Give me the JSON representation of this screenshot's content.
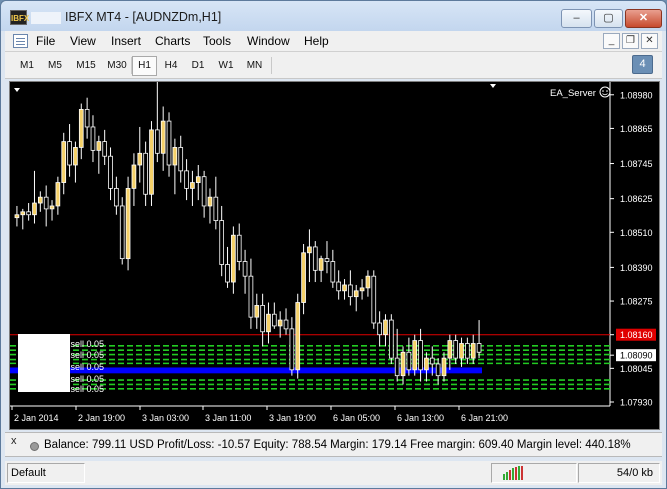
{
  "window": {
    "app_name": "IBFX MT4",
    "title": "IBFX MT4 - [AUDNZDm,H1]",
    "icon_label": "IBFX",
    "controls": {
      "minimize": "–",
      "maximize": "▢",
      "close": "✕"
    }
  },
  "menu": {
    "items": [
      "File",
      "View",
      "Insert",
      "Charts",
      "Tools",
      "Window",
      "Help"
    ],
    "mdi_controls": {
      "minimize": "_",
      "restore": "❐",
      "close": "✕"
    }
  },
  "timeframes": {
    "items": [
      "M1",
      "M5",
      "M15",
      "M30",
      "H1",
      "H4",
      "D1",
      "W1",
      "MN"
    ],
    "active": "H1",
    "badge": "4"
  },
  "chart": {
    "symbol": "AUDNZDm",
    "timeframe": "H1",
    "expert_label": "EA_Server",
    "expert_icon": "smiley-icon",
    "price_labels": [
      "1.08980",
      "1.08865",
      "1.08745",
      "1.08625",
      "1.08510",
      "1.08390",
      "1.08275",
      "1.08160",
      "1.08090",
      "1.08045",
      "1.07930"
    ],
    "time_labels": [
      "2 Jan 2014",
      "2 Jan 19:00",
      "3 Jan 03:00",
      "3 Jan 11:00",
      "3 Jan 19:00",
      "6 Jan 05:00",
      "6 Jan 13:00",
      "6 Jan 21:00"
    ],
    "order_labels": [
      "sell 0.05",
      "sell 0.05",
      "sell 0.05",
      "sell 0.05",
      "sell 0.05"
    ],
    "colors": {
      "background": "#000000",
      "bull_candle": "#f5d169",
      "bear_candle": "#000000",
      "candle_outline": "#ffffff",
      "bid_line": "#e00000",
      "order_lines": "#22cc22",
      "band": "#0000ff"
    }
  },
  "chart_data": {
    "type": "candlestick",
    "title": "",
    "xlabel": "",
    "ylabel": "",
    "ylim": [
      1.0793,
      1.0901
    ],
    "bid_price": 1.0816,
    "ask_price": 1.0809,
    "band": [
      1.08028,
      1.08048
    ],
    "order_levels": [
      1.08122,
      1.08107,
      1.08092,
      1.08075,
      1.08062,
      1.08005,
      1.0799,
      1.07975
    ],
    "candles": [
      [
        1.0856,
        1.086,
        1.0853,
        1.0857
      ],
      [
        1.0857,
        1.0859,
        1.0852,
        1.0858
      ],
      [
        1.0858,
        1.0861,
        1.0855,
        1.0857
      ],
      [
        1.0857,
        1.0872,
        1.0854,
        1.0861
      ],
      [
        1.0861,
        1.0865,
        1.0858,
        1.0863
      ],
      [
        1.0863,
        1.0867,
        1.0853,
        1.0859
      ],
      [
        1.0859,
        1.0862,
        1.0855,
        1.086
      ],
      [
        1.086,
        1.087,
        1.0857,
        1.0868
      ],
      [
        1.0868,
        1.0885,
        1.0864,
        1.0882
      ],
      [
        1.0882,
        1.0888,
        1.087,
        1.0874
      ],
      [
        1.0874,
        1.0882,
        1.0868,
        1.088
      ],
      [
        1.088,
        1.0895,
        1.0876,
        1.0893
      ],
      [
        1.0893,
        1.0897,
        1.0883,
        1.0887
      ],
      [
        1.0887,
        1.0891,
        1.0875,
        1.0879
      ],
      [
        1.0879,
        1.0884,
        1.0871,
        1.0882
      ],
      [
        1.0882,
        1.0886,
        1.0874,
        1.0877
      ],
      [
        1.0877,
        1.088,
        1.0862,
        1.0866
      ],
      [
        1.0866,
        1.087,
        1.0857,
        1.086
      ],
      [
        1.086,
        1.0863,
        1.084,
        1.0842
      ],
      [
        1.0842,
        1.087,
        1.0838,
        1.0866
      ],
      [
        1.0866,
        1.0878,
        1.086,
        1.0874
      ],
      [
        1.0874,
        1.0887,
        1.0868,
        1.0878
      ],
      [
        1.0878,
        1.0882,
        1.086,
        1.0864
      ],
      [
        1.0864,
        1.0889,
        1.086,
        1.0886
      ],
      [
        1.0886,
        1.0905,
        1.0875,
        1.0878
      ],
      [
        1.0878,
        1.0894,
        1.0872,
        1.0889
      ],
      [
        1.0889,
        1.0892,
        1.087,
        1.0874
      ],
      [
        1.0874,
        1.0883,
        1.0864,
        1.088
      ],
      [
        1.088,
        1.0884,
        1.0868,
        1.0872
      ],
      [
        1.0872,
        1.0876,
        1.0862,
        1.0866
      ],
      [
        1.0866,
        1.0872,
        1.086,
        1.0868
      ],
      [
        1.0868,
        1.0874,
        1.0862,
        1.087
      ],
      [
        1.087,
        1.0872,
        1.0856,
        1.086
      ],
      [
        1.086,
        1.0866,
        1.0854,
        1.0863
      ],
      [
        1.0863,
        1.087,
        1.0852,
        1.0855
      ],
      [
        1.0855,
        1.086,
        1.0836,
        1.084
      ],
      [
        1.084,
        1.0846,
        1.0832,
        1.0834
      ],
      [
        1.0834,
        1.0853,
        1.083,
        1.085
      ],
      [
        1.085,
        1.0854,
        1.0838,
        1.0841
      ],
      [
        1.0841,
        1.0845,
        1.083,
        1.0836
      ],
      [
        1.0836,
        1.0842,
        1.0818,
        1.0822
      ],
      [
        1.0822,
        1.083,
        1.0818,
        1.0826
      ],
      [
        1.0826,
        1.083,
        1.0812,
        1.0817
      ],
      [
        1.0817,
        1.0827,
        1.0813,
        1.0823
      ],
      [
        1.0823,
        1.0827,
        1.0818,
        1.0819
      ],
      [
        1.0819,
        1.0824,
        1.0815,
        1.0821
      ],
      [
        1.0821,
        1.0825,
        1.0816,
        1.0818
      ],
      [
        1.0818,
        1.0822,
        1.0802,
        1.0804
      ],
      [
        1.0804,
        1.083,
        1.0801,
        1.0827
      ],
      [
        1.0827,
        1.0847,
        1.0823,
        1.0844
      ],
      [
        1.0844,
        1.0852,
        1.0834,
        1.0846
      ],
      [
        1.0846,
        1.0848,
        1.0834,
        1.0838
      ],
      [
        1.0838,
        1.0843,
        1.0834,
        1.0842
      ],
      [
        1.0842,
        1.0848,
        1.0837,
        1.0841
      ],
      [
        1.0841,
        1.0845,
        1.0832,
        1.0834
      ],
      [
        1.0834,
        1.0838,
        1.0828,
        1.0831
      ],
      [
        1.0831,
        1.0835,
        1.0828,
        1.0833
      ],
      [
        1.0833,
        1.0838,
        1.0826,
        1.0829
      ],
      [
        1.0829,
        1.0833,
        1.0824,
        1.0831
      ],
      [
        1.0831,
        1.0835,
        1.0828,
        1.0832
      ],
      [
        1.0832,
        1.0838,
        1.0829,
        1.0836
      ],
      [
        1.0836,
        1.0838,
        1.0818,
        1.082
      ],
      [
        1.082,
        1.0824,
        1.0812,
        1.0816
      ],
      [
        1.0816,
        1.0823,
        1.0812,
        1.0821
      ],
      [
        1.0821,
        1.0823,
        1.0806,
        1.0808
      ],
      [
        1.0808,
        1.0818,
        1.08,
        1.0802
      ],
      [
        1.0802,
        1.0812,
        1.0799,
        1.081
      ],
      [
        1.081,
        1.0815,
        1.0802,
        1.0804
      ],
      [
        1.0804,
        1.0816,
        1.0802,
        1.0814
      ],
      [
        1.0814,
        1.0818,
        1.08,
        1.0804
      ],
      [
        1.0804,
        1.081,
        1.08,
        1.0808
      ],
      [
        1.0808,
        1.0812,
        1.0802,
        1.0806
      ],
      [
        1.0806,
        1.0808,
        1.0799,
        1.0802
      ],
      [
        1.0802,
        1.081,
        1.08,
        1.0808
      ],
      [
        1.0808,
        1.0816,
        1.0804,
        1.0814
      ],
      [
        1.0814,
        1.0816,
        1.0806,
        1.0808
      ],
      [
        1.0808,
        1.0815,
        1.0805,
        1.0813
      ],
      [
        1.0813,
        1.0815,
        1.0806,
        1.0808
      ],
      [
        1.0808,
        1.0816,
        1.0806,
        1.0813
      ],
      [
        1.0813,
        1.0821,
        1.0808,
        1.081
      ]
    ]
  },
  "indicator": {
    "close_label": "x",
    "summary": "Balance: 799.11 USD  Profit/Loss: -10.57  Equity: 788.54  Margin: 179.14  Free margin: 609.40  Margin level: 440.18%"
  },
  "status": {
    "profile": "Default",
    "traffic": "54/0 kb"
  }
}
